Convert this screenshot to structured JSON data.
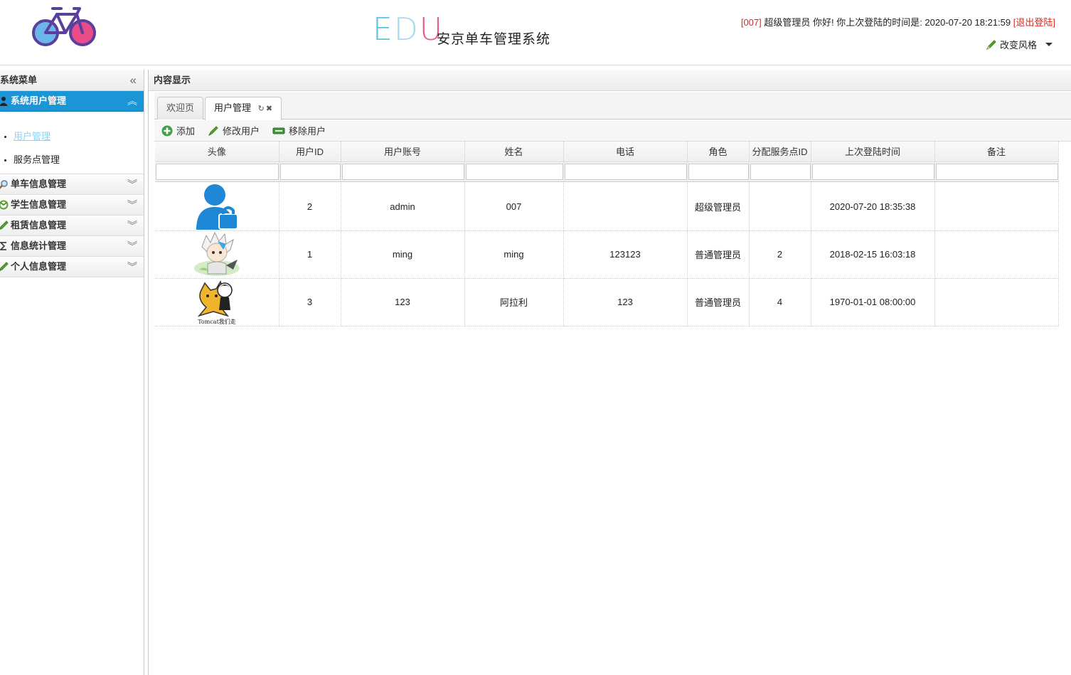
{
  "header": {
    "brand_letters": [
      "E",
      "D",
      "U"
    ],
    "subtitle": "安京单车管理系统",
    "user_id": "[007]",
    "greeting": " 超级管理员 你好! 你上次登陆的时间是: ",
    "last_login": "2020-07-20 18:21:59",
    "logout": "[退出登陆]",
    "theme": "改变风格"
  },
  "sidebar": {
    "title": "系统菜单",
    "collapse_icon": "double-chevron-left-icon",
    "groups": [
      {
        "label": "系统用户管理",
        "icon": "user-icon",
        "expanded": true,
        "items": [
          {
            "label": "用户管理",
            "selected": true
          },
          {
            "label": "服务点管理"
          }
        ]
      },
      {
        "label": "单车信息管理",
        "icon": "search-icon"
      },
      {
        "label": "学生信息管理",
        "icon": "people-icon"
      },
      {
        "label": "租赁信息管理",
        "icon": "pencil-icon"
      },
      {
        "label": "信息统计管理",
        "icon": "sigma-icon"
      },
      {
        "label": "个人信息管理",
        "icon": "pencil-icon"
      }
    ]
  },
  "content": {
    "title": "内容显示",
    "tabs": [
      {
        "label": "欢迎页"
      },
      {
        "label": "用户管理",
        "active": true
      }
    ],
    "toolbar": {
      "add": "添加",
      "edit": "修改用户",
      "remove": "移除用户"
    },
    "columns": [
      "头像",
      "用户ID",
      "用户账号",
      "姓名",
      "电话",
      "角色",
      "分配服务点ID",
      "上次登陆时间",
      "备注"
    ],
    "rows": [
      {
        "avatar": "user-lock-avatar",
        "id": "2",
        "account": "admin",
        "name": "007",
        "phone": "",
        "role": "超级管理员",
        "station": "",
        "last_login": "2020-07-20 18:35:38",
        "note": ""
      },
      {
        "avatar": "anime-avatar",
        "id": "1",
        "account": "ming",
        "name": "ming",
        "phone": "123123",
        "role": "普通管理员",
        "station": "2",
        "last_login": "2018-02-15 16:03:18",
        "note": ""
      },
      {
        "avatar": "tomcat-avatar",
        "id": "3",
        "account": "123",
        "name": "阿拉利",
        "phone": "123",
        "role": "普通管理员",
        "station": "4",
        "last_login": "1970-01-01 08:00:00",
        "note": ""
      }
    ],
    "tomcat_caption": "Tomcat我们走"
  },
  "colors": {
    "accent": "#1b95d6",
    "alert": "#d9281c",
    "selected_link": "#8fd4f0"
  }
}
